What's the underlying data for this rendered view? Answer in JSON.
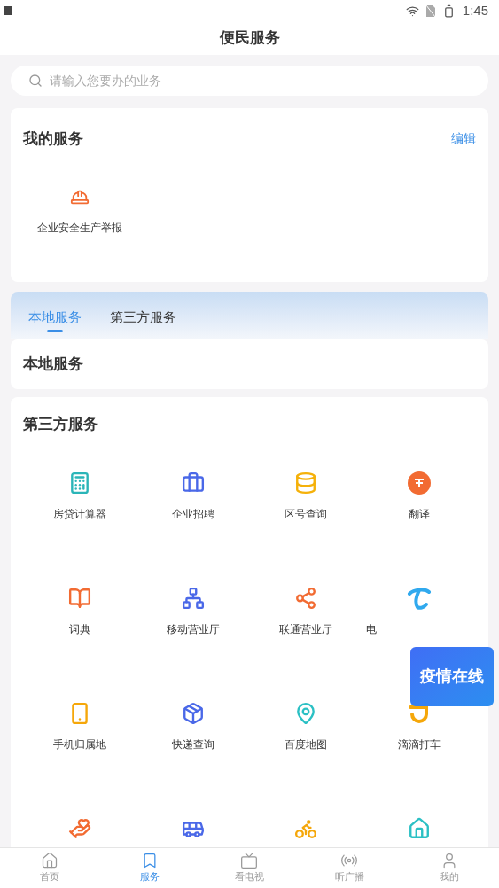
{
  "status_bar": {
    "time": "1:45"
  },
  "header": {
    "title": "便民服务"
  },
  "search": {
    "placeholder": "请输入您要办的业务"
  },
  "my_services": {
    "title": "我的服务",
    "edit": "编辑",
    "items": [
      {
        "label": "企业安全生产举报"
      }
    ]
  },
  "tabs": [
    {
      "label": "本地服务",
      "selected": true
    },
    {
      "label": "第三方服务",
      "selected": false
    }
  ],
  "local_services": {
    "title": "本地服务"
  },
  "third_party": {
    "title": "第三方服务",
    "items": [
      {
        "kind": "labeled",
        "label": "房贷计算器"
      },
      {
        "kind": "labeled",
        "label": "企业招聘"
      },
      {
        "kind": "labeled",
        "label": "区号查询"
      },
      {
        "kind": "labeled",
        "label": "翻译"
      },
      {
        "kind": "labeled",
        "label": "词典"
      },
      {
        "kind": "labeled",
        "label": "移动营业厅"
      },
      {
        "kind": "labeled",
        "label": "联通营业厅"
      },
      {
        "kind": "partly_covered",
        "label": "电"
      },
      {
        "kind": "labeled",
        "label": "手机归属地"
      },
      {
        "kind": "labeled",
        "label": "快递查询"
      },
      {
        "kind": "labeled",
        "label": "百度地图"
      },
      {
        "kind": "labeled",
        "label": "滴滴打车"
      },
      {
        "kind": "icon_only"
      },
      {
        "kind": "icon_only"
      },
      {
        "kind": "icon_only"
      },
      {
        "kind": "icon_only"
      }
    ]
  },
  "floating_banner": {
    "text": "疫情在线"
  },
  "bottom_nav": [
    {
      "label": "首页",
      "selected": false
    },
    {
      "label": "服务",
      "selected": true
    },
    {
      "label": "看电视",
      "selected": false
    },
    {
      "label": "听广播",
      "selected": false
    },
    {
      "label": "我的",
      "selected": false
    }
  ]
}
